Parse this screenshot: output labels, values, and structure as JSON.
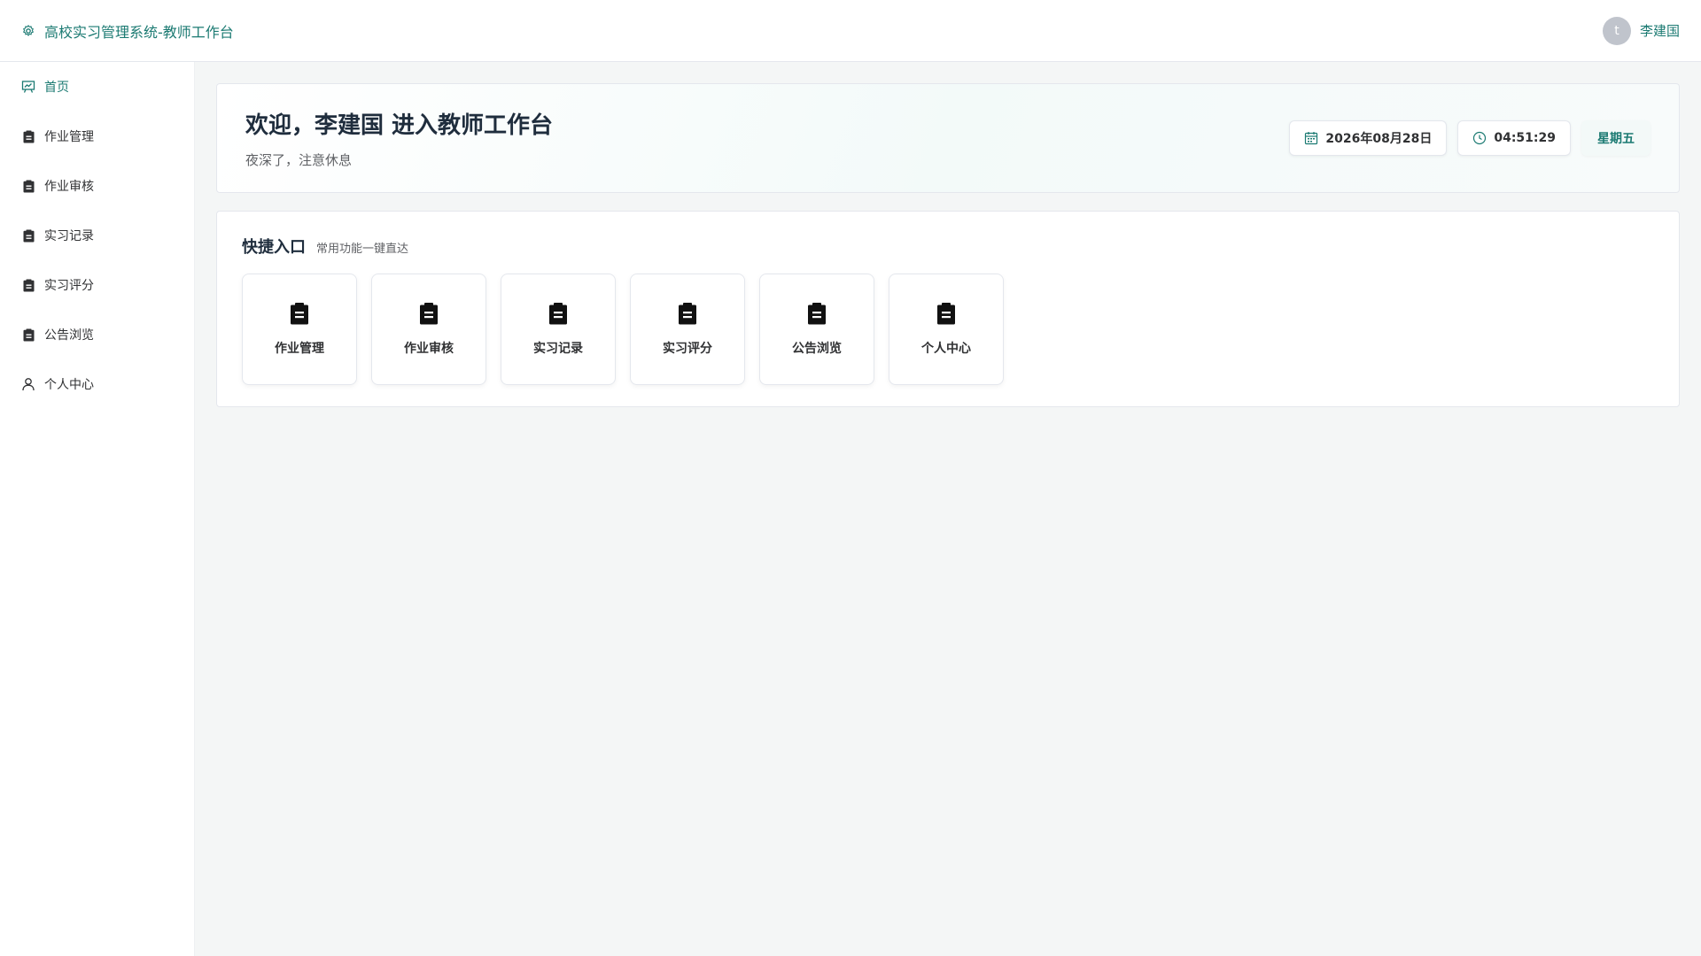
{
  "header": {
    "title": "高校实习管理系统-教师工作台",
    "title_icon": "gear-icon",
    "user": {
      "avatar_letter": "t",
      "name": "李建国"
    }
  },
  "sidebar": {
    "items": [
      {
        "label": "首页",
        "icon": "dashboard-icon",
        "active": true
      },
      {
        "label": "作业管理",
        "icon": "clipboard-icon"
      },
      {
        "label": "作业审核",
        "icon": "clipboard-icon"
      },
      {
        "label": "实习记录",
        "icon": "clipboard-icon"
      },
      {
        "label": "实习评分",
        "icon": "clipboard-icon"
      },
      {
        "label": "公告浏览",
        "icon": "clipboard-icon"
      },
      {
        "label": "个人中心",
        "icon": "user-icon"
      }
    ]
  },
  "welcome": {
    "title": "欢迎，李建国 进入教师工作台",
    "subtitle": "夜深了，注意休息",
    "date": "2026年08月28日",
    "time": "04:51:29",
    "weekday": "星期五"
  },
  "quick": {
    "title": "快捷入口",
    "subtitle": "常用功能一键直达",
    "cards": [
      {
        "label": "作业管理",
        "icon": "clipboard-icon"
      },
      {
        "label": "作业审核",
        "icon": "clipboard-icon"
      },
      {
        "label": "实习记录",
        "icon": "clipboard-icon"
      },
      {
        "label": "实习评分",
        "icon": "clipboard-icon"
      },
      {
        "label": "公告浏览",
        "icon": "clipboard-icon"
      },
      {
        "label": "个人中心",
        "icon": "clipboard-icon"
      }
    ]
  },
  "colors": {
    "accent": "#1b7a72",
    "background": "#f4f6f6",
    "border": "#e4e7ed"
  }
}
